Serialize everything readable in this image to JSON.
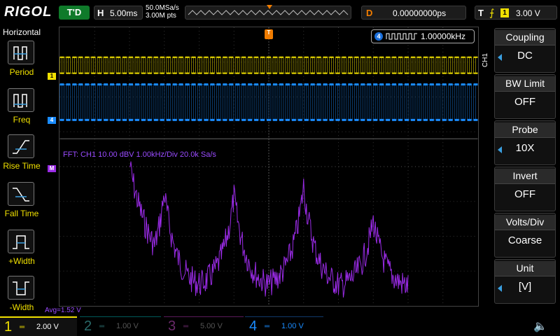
{
  "header": {
    "brand": "RIGOL",
    "run_status": "T'D",
    "horizontal": {
      "key": "H",
      "value": "5.00ms"
    },
    "sample_rate": "50.0MSa/s",
    "memory_depth": "3.00M pts",
    "delay": {
      "key": "D",
      "value": "0.00000000ps"
    },
    "trigger": {
      "key": "T",
      "source": "1",
      "level": "3.00 V"
    }
  },
  "left_menu": {
    "title": "Horizontal",
    "items": [
      {
        "label": "Period",
        "icon": "period-icon"
      },
      {
        "label": "Freq",
        "icon": "freq-icon"
      },
      {
        "label": "Rise Time",
        "icon": "rise-time-icon"
      },
      {
        "label": "Fall Time",
        "icon": "fall-time-icon"
      },
      {
        "label": "+Width",
        "icon": "pos-width-icon"
      },
      {
        "label": "-Width",
        "icon": "neg-width-icon"
      }
    ]
  },
  "right_menu": {
    "channel_tab": "CH1",
    "items": [
      {
        "title": "Coupling",
        "value": "DC",
        "has_arrow": true
      },
      {
        "title": "BW Limit",
        "value": "OFF",
        "has_arrow": false
      },
      {
        "title": "Probe",
        "value": "10X",
        "has_arrow": true
      },
      {
        "title": "Invert",
        "value": "OFF",
        "has_arrow": false
      },
      {
        "title": "Volts/Div",
        "value": "Coarse",
        "has_arrow": false
      },
      {
        "title": "Unit",
        "value": "[V]",
        "has_arrow": true
      }
    ]
  },
  "freq_counter": {
    "channel": "4",
    "value": "1.00000kHz"
  },
  "fft": {
    "label": "FFT:  CH1  10.00 dBV   1.00kHz/Div    20.0k Sa/s",
    "marker": "M"
  },
  "avg": "Avg=1.52 V",
  "markers": {
    "ch1": "1",
    "ch4": "4",
    "trigger_pos": "T"
  },
  "channels": [
    {
      "num": "1",
      "volts": "2.00 V",
      "color": "#f0e000",
      "active": true
    },
    {
      "num": "2",
      "volts": "1.00 V",
      "color": "#00c8c8",
      "active": false
    },
    {
      "num": "3",
      "volts": "5.00 V",
      "color": "#d040d0",
      "active": false
    },
    {
      "num": "4",
      "volts": "1.00 V",
      "color": "#1a8cff",
      "active": false
    }
  ],
  "colors": {
    "ch1": "#f0e000",
    "ch4": "#1a8cff",
    "fft": "#9a2be6",
    "trigger": "#f07c00"
  }
}
